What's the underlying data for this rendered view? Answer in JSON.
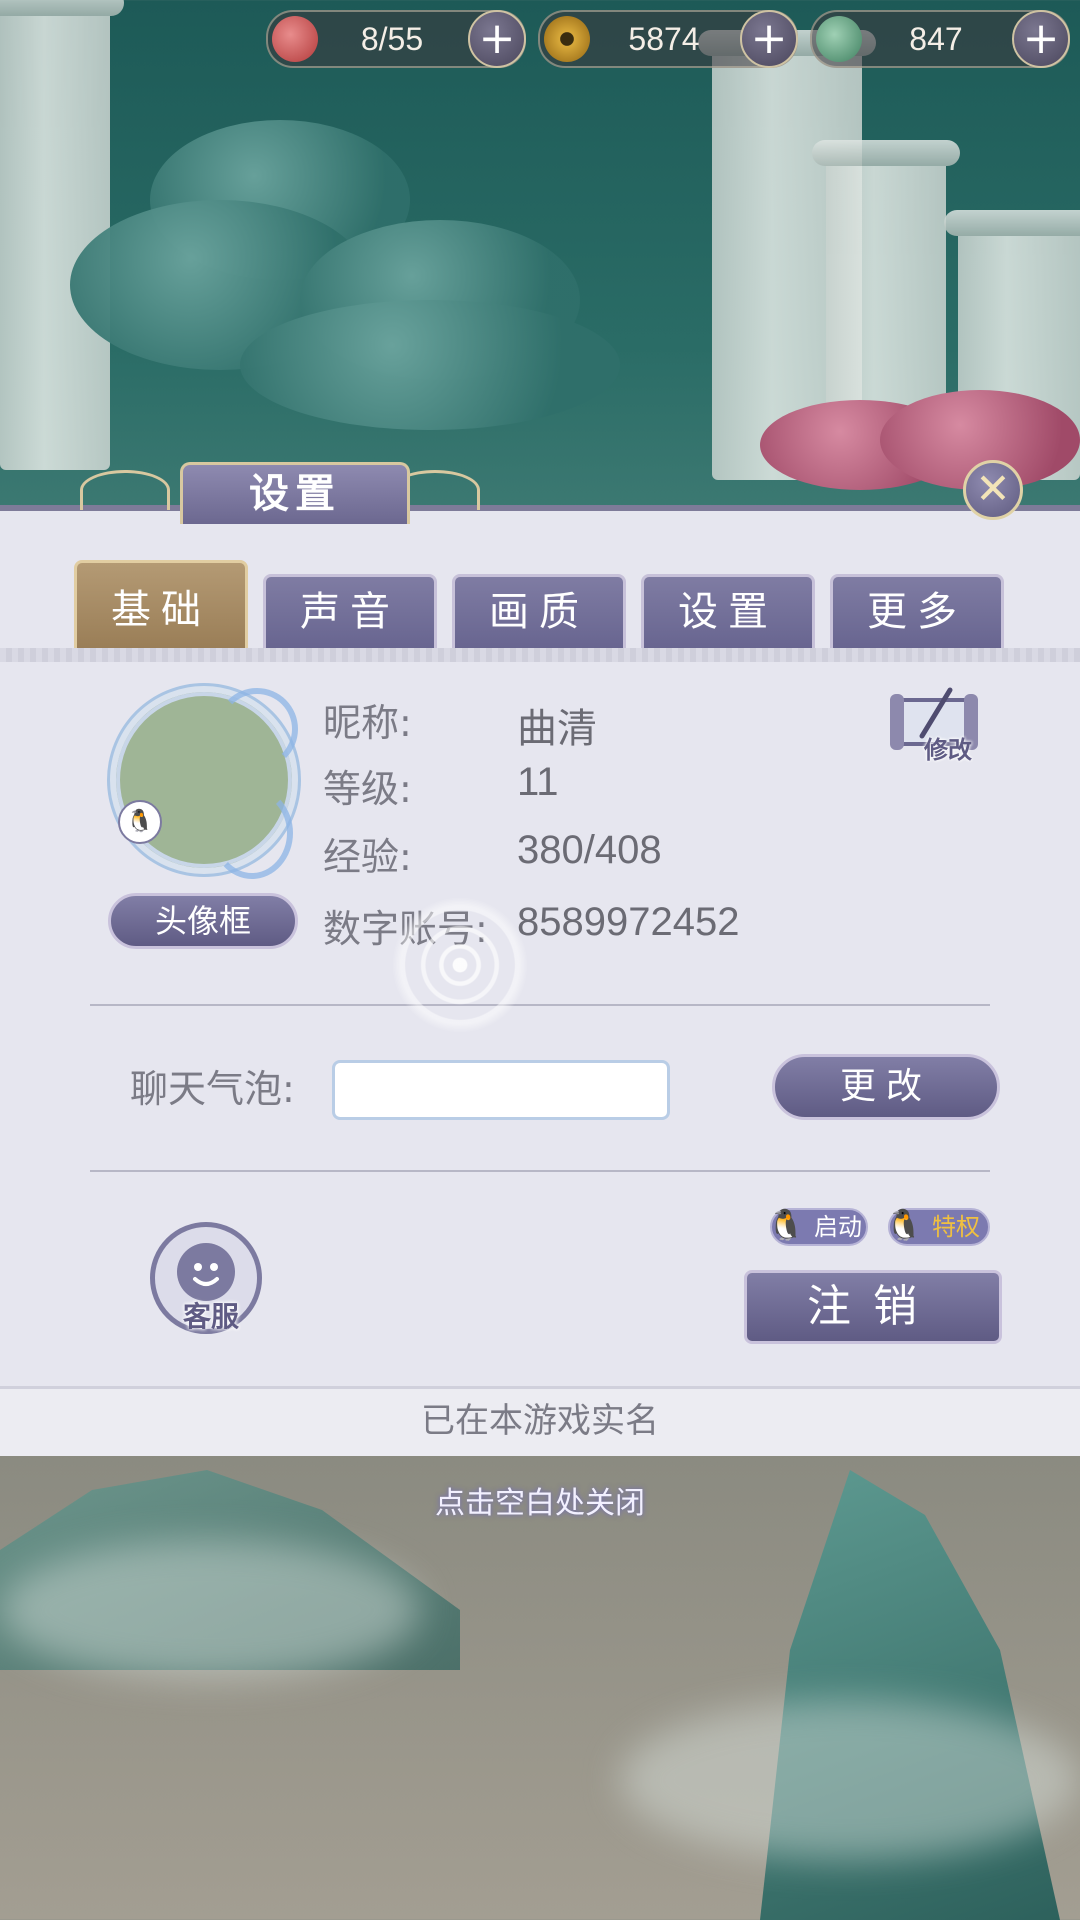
{
  "resources": [
    {
      "icon": "heart-icon",
      "value": "8/55"
    },
    {
      "icon": "coin-icon",
      "value": "5874"
    },
    {
      "icon": "jade-icon",
      "value": "847"
    }
  ],
  "dialog": {
    "title": "设置",
    "tabs": [
      "基础",
      "声音",
      "画质",
      "设置",
      "更多"
    ],
    "active_tab": "基础"
  },
  "profile": {
    "frame_button": "头像框",
    "edit_label": "修改",
    "fields": [
      {
        "label": "昵称:",
        "value": "曲清"
      },
      {
        "label": "等级:",
        "value": "11"
      },
      {
        "label": "经验:",
        "value": "380/408"
      },
      {
        "label": "数字账号:",
        "value": "8589972452"
      }
    ]
  },
  "chat_bubble": {
    "label": "聊天气泡:",
    "change_button": "更改"
  },
  "bottom": {
    "service_label": "客服",
    "qq_launch": "启动",
    "qq_privilege": "特权",
    "logout_button": "注销"
  },
  "footer": {
    "realname_text": "已在本游戏实名",
    "close_hint": "点击空白处关闭"
  },
  "colors": {
    "accent": "#6c6890",
    "active_tab": "#9a7e57",
    "panel": "#e6e6ef"
  }
}
